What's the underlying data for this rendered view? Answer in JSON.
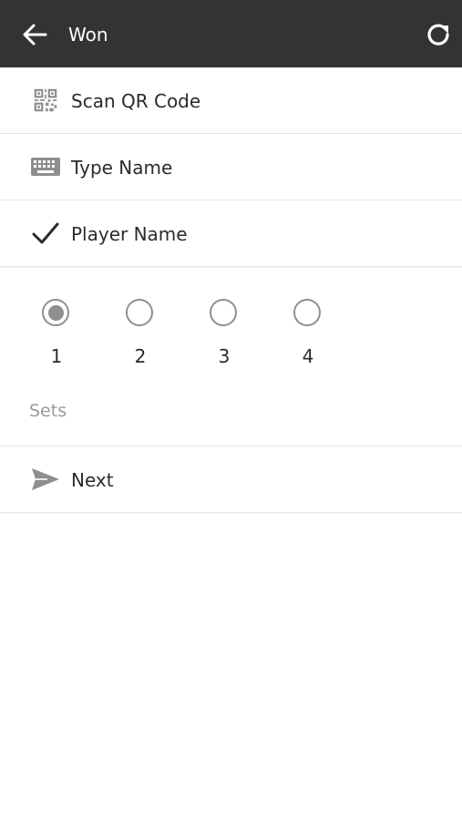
{
  "header": {
    "title": "Won",
    "back_icon": "arrow-left-icon",
    "refresh_icon": "refresh-icon",
    "background": "#333333"
  },
  "actions": [
    {
      "label": "Scan QR Code",
      "icon": "qr-code-icon"
    },
    {
      "label": "Type Name",
      "icon": "keyboard-icon"
    },
    {
      "label": "Player Name",
      "icon": "checkmark-icon"
    }
  ],
  "sets": {
    "label": "Sets",
    "options": [
      "1",
      "2",
      "3",
      "4"
    ],
    "selected": "1"
  },
  "next": {
    "label": "Next",
    "icon": "send-icon"
  }
}
